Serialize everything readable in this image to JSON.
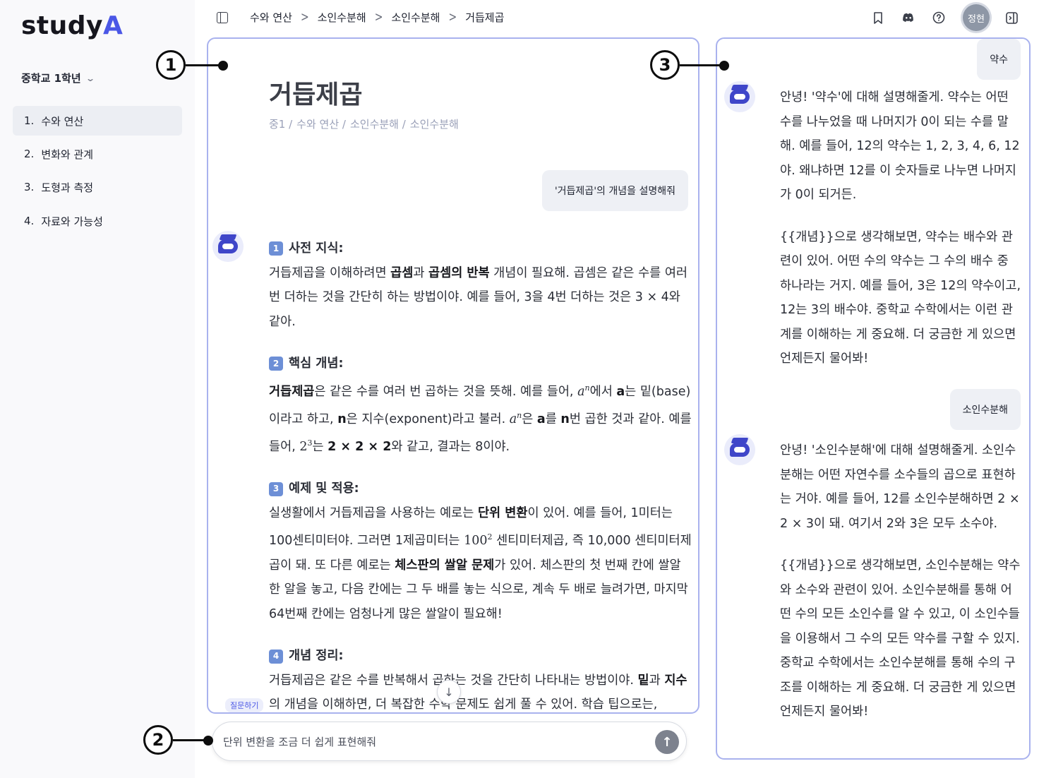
{
  "app": {
    "logo_text": "study",
    "logo_accent": "A"
  },
  "sidebar": {
    "grade": "중학교 1학년",
    "items": [
      {
        "num": "1.",
        "label": "수와 연산"
      },
      {
        "num": "2.",
        "label": "변화와 관계"
      },
      {
        "num": "3.",
        "label": "도형과 측정"
      },
      {
        "num": "4.",
        "label": "자료와 가능성"
      }
    ]
  },
  "header": {
    "breadcrumb": [
      "수와 연산",
      "소인수분해",
      "소인수분해",
      "거듭제곱"
    ],
    "avatar_text": "정현",
    "icons": [
      "sidebar-toggle-icon",
      "bookmark-icon",
      "discord-icon",
      "help-icon",
      "panel-toggle-icon"
    ]
  },
  "main": {
    "title": "거듭제곱",
    "crumb": [
      "중1 /",
      "수와 연산 /",
      "소인수분해 /",
      "소인수분해"
    ],
    "user_question": "'거듭제곱'의 개념을 설명해줘",
    "sections": [
      {
        "num": "1",
        "title": "사전 지식:",
        "parts": [
          "거듭제곱을 이해하려면 ",
          "곱셈",
          "과 ",
          "곱셈의 반복",
          " 개념이 필요해. 곱셈은 같은 수를 여러 번 더하는 것을 간단히 하는 방법이야. 예를 들어, 3을 4번 더하는 것은 3 × 4와 같아."
        ]
      },
      {
        "num": "2",
        "title": "핵심 개념:",
        "p1": "거듭제곱",
        "p2": "은 같은 수를 여러 번 곱하는 것을 뜻해. 예를 들어, ",
        "math_a": "a",
        "math_n": "n",
        "p3": "에서 ",
        "bold_a": "a",
        "p4": "는 밑(base)이라고 하고, ",
        "bold_n": "n",
        "p5": "은 지수(exponent)라고 불러. ",
        "p6": "은 ",
        "p7": "를 ",
        "p8": "번 곱한 것과 같아. 예를 들어, ",
        "math_base": "2",
        "math_exp": "3",
        "p9": "는 ",
        "bold_expr": "2 × 2 × 2",
        "p10": "와 같고, 결과는 8이야."
      },
      {
        "num": "3",
        "title": "예제 및 적용:",
        "p1": "실생활에서 거듭제곱을 사용하는 예로는 ",
        "b1": "단위 변환",
        "p2": "이 있어. 예를 들어, 1미터는 100센티미터야. 그러면 1제곱미터는 ",
        "math_base": "100",
        "math_exp": "2",
        "p3": " 센티미터제곱, 즉 10,000 센티미터제곱이 돼. 또 다른 예로는 ",
        "b2": "체스판의 쌀알 문제",
        "p4": "가 있어. 체스판의 첫 번째 칸에 쌀알 한 알을 놓고, 다음 칸에는 그 두 배를 놓는 식으로, 계속 두 배로 늘려가면, 마지막 64번째 칸에는 엄청나게 많은 쌀알이 필요해!"
      },
      {
        "num": "4",
        "title": "개념 정리:",
        "p1": "거듭제곱은 같은 수를 반복해서 곱하는 것을 간단히 나타내는 방법이야. ",
        "b1": "밑",
        "p2": "과 ",
        "b2": "지수",
        "p3": "의 개념을 이해하면, 더 복잡한 수학 문제도 쉽게 풀 수 있어. 학습 팁으로는,"
      }
    ],
    "ask_tag": "질문하기"
  },
  "input": {
    "value": "단위 변환을 조금 더 쉽게 표현해줘"
  },
  "right_panel": {
    "messages": [
      {
        "role": "user",
        "text": "약수"
      },
      {
        "role": "bot",
        "paras": [
          "안녕! '약수'에 대해 설명해줄게. 약수는 어떤 수를 나누었을 때 나머지가 0이 되는 수를 말해. 예를 들어, 12의 약수는 1, 2, 3, 4, 6, 12야. 왜냐하면 12를 이 숫자들로 나누면 나머지가 0이 되거든.",
          "{{개념}}으로 생각해보면, 약수는 배수와 관련이 있어. 어떤 수의 약수는 그 수의 배수 중 하나라는 거지. 예를 들어, 3은 12의 약수이고, 12는 3의 배수야. 중학교 수학에서는 이런 관계를 이해하는 게 중요해. 더 궁금한 게 있으면 언제든지 물어봐!"
        ]
      },
      {
        "role": "user",
        "text": "소인수분해"
      },
      {
        "role": "bot",
        "paras": [
          "안녕! '소인수분해'에 대해 설명해줄게. 소인수분해는 어떤 자연수를 소수들의 곱으로 표현하는 거야. 예를 들어, 12를 소인수분해하면 2 × 2 × 3이 돼. 여기서 2와 3은 모두 소수야.",
          "{{개념}}으로 생각해보면, 소인수분해는 약수와 소수와 관련이 있어. 소인수분해를 통해 어떤 수의 모든 소인수를 알 수 있고, 이 소인수들을 이용해서 그 수의 모든 약수를 구할 수 있지. 중학교 수학에서는 소인수분해를 통해 수의 구조를 이해하는 게 중요해. 더 궁금한 게 있으면 언제든지 물어봐!"
        ]
      }
    ]
  },
  "callouts": [
    "1",
    "2",
    "3"
  ],
  "colors": {
    "accent": "#4b57e6",
    "panel_border": "#a9b2ee",
    "bubble": "#eef0f5"
  }
}
